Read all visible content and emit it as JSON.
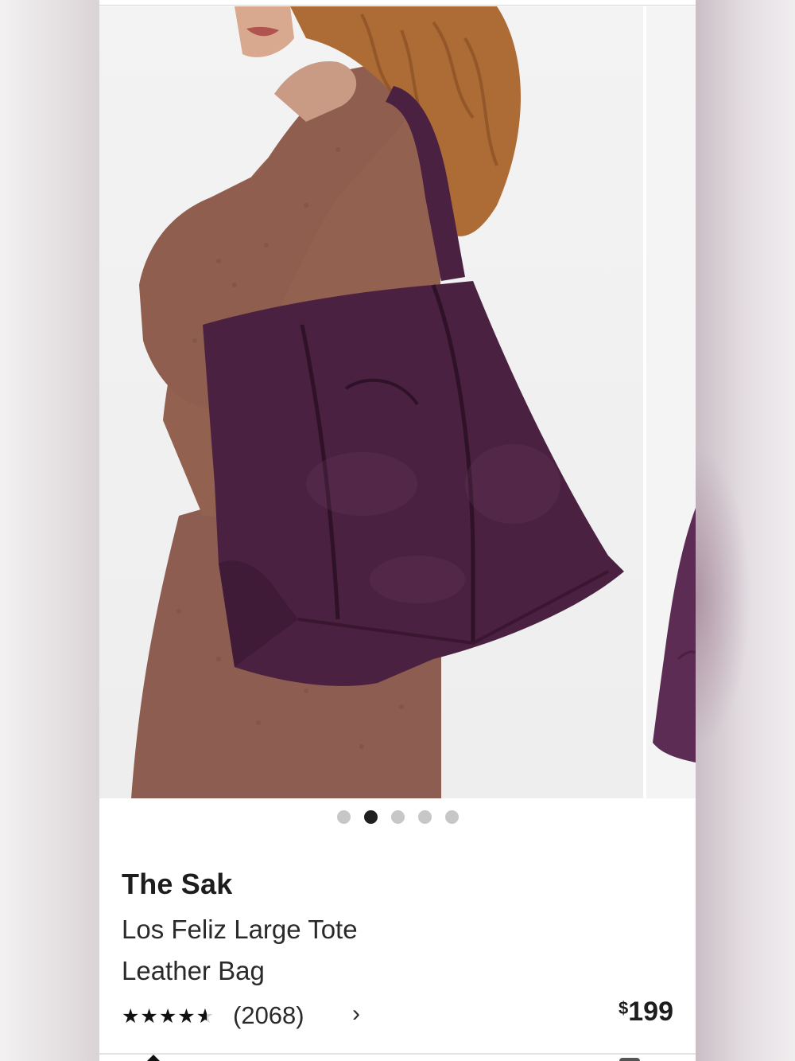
{
  "product": {
    "brand": "The Sak",
    "name": "Los Feliz Large Tote Leather Bag",
    "review_count": "(2068)",
    "rating_stars": 4.6,
    "price_symbol": "$",
    "price_value": "199"
  },
  "carousel": {
    "total_images": 5,
    "active_index": 1
  },
  "icons": {
    "reviews_chevron": "chevron-right-icon",
    "star": "star-icon"
  },
  "colors": {
    "bag": "#4a2140",
    "sweater": "#8a5a4e",
    "hair": "#b06a34",
    "active_dot": "#1f1f1f",
    "inactive_dot": "#c7c7c7"
  }
}
